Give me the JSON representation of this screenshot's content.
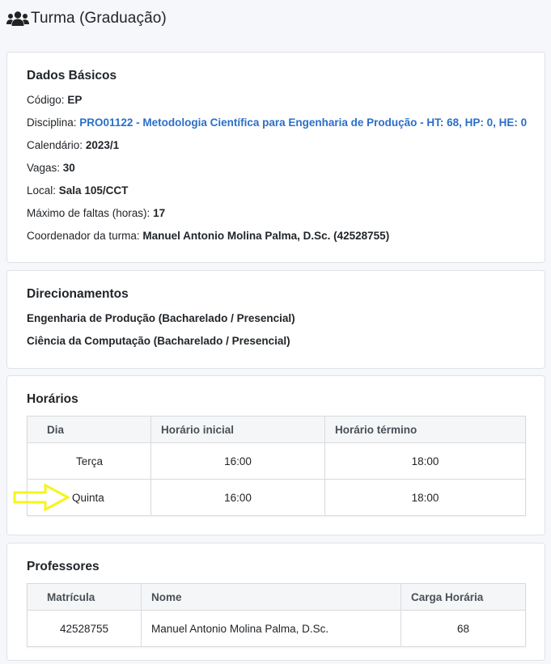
{
  "header": {
    "title": "Turma (Graduação)",
    "icon": "users-icon"
  },
  "dados_basicos": {
    "title": "Dados Básicos",
    "codigo_label": "Código:",
    "codigo_value": "EP",
    "disciplina_label": "Disciplina:",
    "disciplina_value": "PRO01122 - Metodologia Científica para Engenharia de Produção - HT: 68, HP: 0, HE: 0",
    "calendario_label": "Calendário:",
    "calendario_value": "2023/1",
    "vagas_label": "Vagas:",
    "vagas_value": "30",
    "local_label": "Local:",
    "local_value": "Sala 105/CCT",
    "faltas_label": "Máximo de faltas (horas):",
    "faltas_value": "17",
    "coordenador_label": "Coordenador da turma:",
    "coordenador_value": "Manuel Antonio Molina Palma, D.Sc. (42528755)"
  },
  "direcionamentos": {
    "title": "Direcionamentos",
    "items": [
      "Engenharia de Produção (Bacharelado / Presencial)",
      "Ciência da Computação (Bacharelado / Presencial)"
    ]
  },
  "horarios": {
    "title": "Horários",
    "columns": [
      "Dia",
      "Horário inicial",
      "Horário término"
    ],
    "rows": [
      {
        "dia": "Terça",
        "inicio": "16:00",
        "fim": "18:00"
      },
      {
        "dia": "Quinta",
        "inicio": "16:00",
        "fim": "18:00"
      }
    ],
    "highlight_color": "#f5f51a"
  },
  "professores": {
    "title": "Professores",
    "columns": [
      "Matrícula",
      "Nome",
      "Carga Horária"
    ],
    "rows": [
      {
        "matricula": "42528755",
        "nome": "Manuel Antonio Molina Palma, D.Sc.",
        "carga": "68"
      }
    ]
  },
  "colors": {
    "link": "#2a6fc9",
    "background": "#f6f7fb",
    "border": "#dfe2e6"
  }
}
